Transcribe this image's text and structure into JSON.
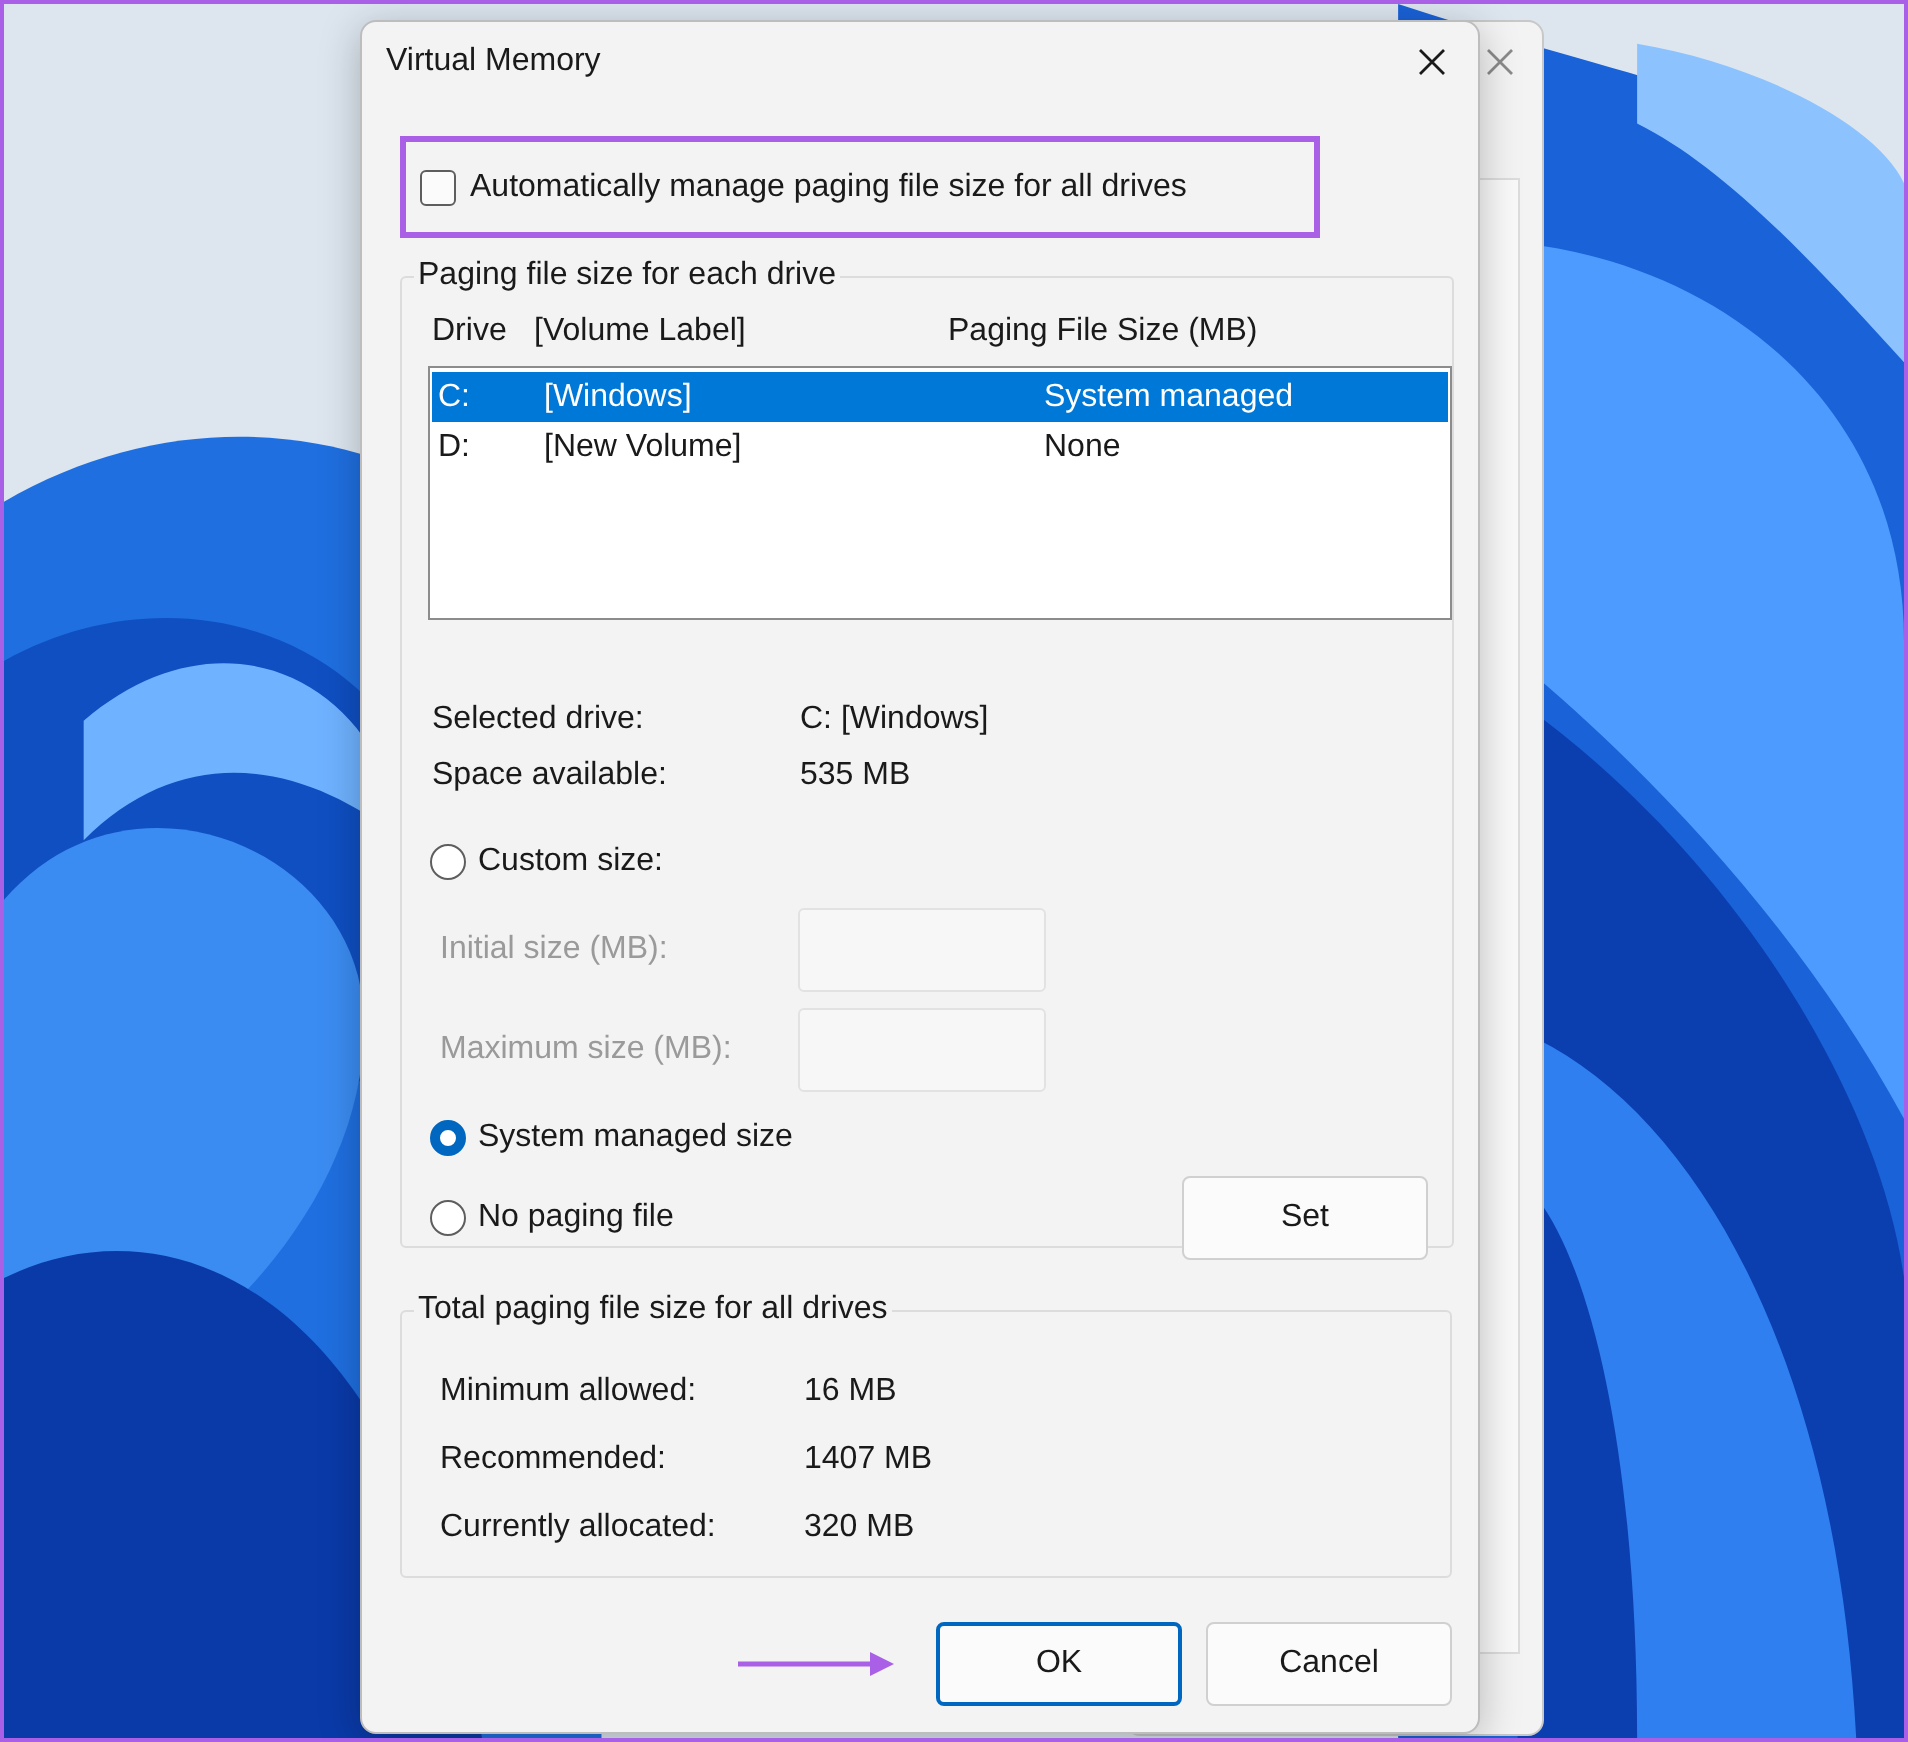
{
  "window": {
    "title": "Virtual Memory"
  },
  "auto_manage": {
    "label": "Automatically manage paging file size for all drives",
    "checked": false
  },
  "drives_group": {
    "title": "Paging file size for each drive",
    "columns": [
      "Drive",
      "[Volume Label]",
      "Paging File Size (MB)"
    ],
    "rows": [
      {
        "drive": "C:",
        "volume": "[Windows]",
        "size": "System managed",
        "selected": true
      },
      {
        "drive": "D:",
        "volume": "[New Volume]",
        "size": "None",
        "selected": false
      }
    ],
    "info": [
      {
        "label": "Selected drive:",
        "value": "C:  [Windows]"
      },
      {
        "label": "Space available:",
        "value": "535 MB"
      }
    ],
    "options": [
      {
        "kind": "radio",
        "label": "Custom size:",
        "selected": false
      },
      {
        "kind": "field",
        "label": "Initial size (MB):",
        "disabled": true
      },
      {
        "kind": "field",
        "label": "Maximum size (MB):",
        "disabled": true
      },
      {
        "kind": "radio",
        "label": "System managed size",
        "selected": true
      },
      {
        "kind": "radio",
        "label": "No paging file",
        "selected": false
      }
    ],
    "set_button": "Set"
  },
  "totals_group": {
    "title": "Total paging file size for all drives",
    "rows": [
      {
        "label": "Minimum allowed:",
        "value": "16 MB"
      },
      {
        "label": "Recommended:",
        "value": "1407 MB"
      },
      {
        "label": "Currently allocated:",
        "value": "320 MB"
      }
    ]
  },
  "buttons": [
    {
      "label": "OK",
      "default": true
    },
    {
      "label": "Cancel",
      "default": false
    }
  ]
}
